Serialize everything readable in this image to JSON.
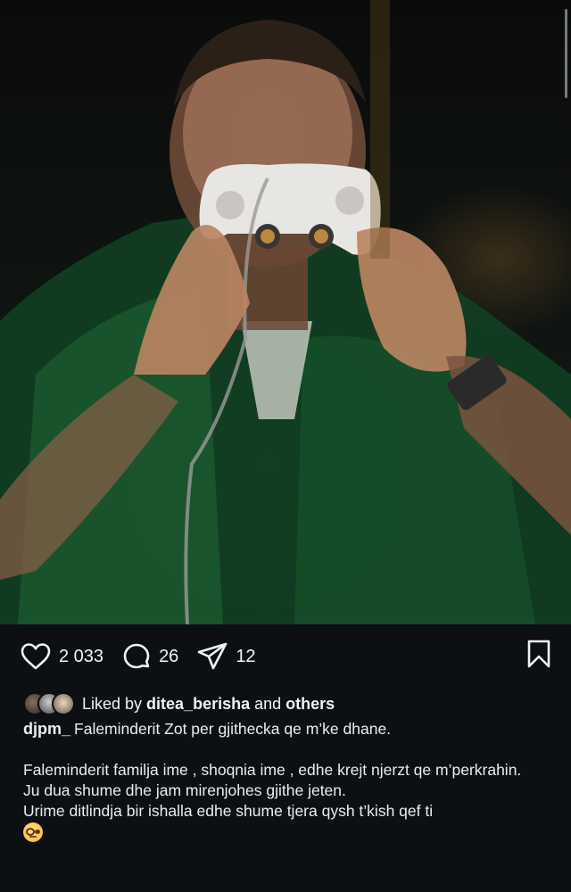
{
  "post": {
    "image_alt_icon": "post-photo",
    "likes": "2 033",
    "comments": "26",
    "shares": "12"
  },
  "liked_by": {
    "prefix": "Liked by ",
    "user": "ditea_berisha",
    "middle": " and ",
    "others": "others"
  },
  "caption": {
    "username": "djpm_",
    "line1": "Faleminderit Zot per gjithecka qe m’ke dhane.",
    "line2": "Faleminderit familja ime , shoqnia ime , edhe krejt njerzt qe m’perkrahin.",
    "line3": "Ju dua shume dhe jam mirenjohes gjithe jeten.",
    "line4": "Urime ditlindja bir ishalla edhe shume tjera qysh t’kish qef ti"
  },
  "colors": {
    "background": "#0c0f14",
    "text": "#f2f2f2"
  },
  "icons": [
    "heart-icon",
    "comment-icon",
    "share-icon",
    "bookmark-icon",
    "nerd-face-emoji-icon"
  ]
}
